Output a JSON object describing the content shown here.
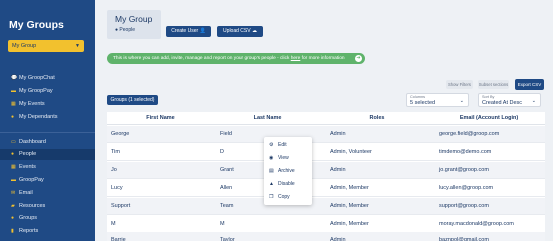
{
  "sidebar": {
    "title": "My Groups",
    "group_select": "My Group",
    "items": [
      {
        "label": "My GroopChat",
        "icon": "chat-icon",
        "glyph": "💬"
      },
      {
        "label": "My GroopPay",
        "icon": "card-icon",
        "glyph": "▬"
      },
      {
        "label": "My Events",
        "icon": "calendar-icon",
        "glyph": "▦"
      },
      {
        "label": "My Dependants",
        "icon": "users-icon",
        "glyph": "●"
      },
      {
        "label": "Dashboard",
        "icon": "dashboard-icon",
        "glyph": "▭"
      },
      {
        "label": "People",
        "icon": "people-icon",
        "glyph": "●"
      },
      {
        "label": "Events",
        "icon": "calendar-icon",
        "glyph": "▦"
      },
      {
        "label": "GroopPay",
        "icon": "card-icon",
        "glyph": "▬"
      },
      {
        "label": "Email",
        "icon": "mail-icon",
        "glyph": "✉"
      },
      {
        "label": "Resources",
        "icon": "folder-icon",
        "glyph": "▰"
      },
      {
        "label": "Groups",
        "icon": "groups-icon",
        "glyph": "●"
      },
      {
        "label": "Reports",
        "icon": "chart-icon",
        "glyph": "▮"
      }
    ]
  },
  "header": {
    "title": "My Group",
    "subtitle": "People",
    "create_user": "Create User",
    "upload_csv": "Upload CSV"
  },
  "banner": {
    "text_before": "This is where you can add, invite, manage and report on your group's people - click ",
    "link": "here",
    "text_after": " for more information"
  },
  "toolbar": {
    "show_filters": "Show Filters",
    "subset_sections": "Subset sections",
    "export_csv": "Export CSV",
    "groups_button": "Groups (1 selected)",
    "columns_label": "Columns",
    "columns_value": "5 selected",
    "sort_label": "Sort By",
    "sort_value": "Created At Desc"
  },
  "table": {
    "headers": [
      "First Name",
      "Last Name",
      "Roles",
      "Email (Account Login)"
    ],
    "rows": [
      {
        "first": "George",
        "last": "Field",
        "roles": "Admin",
        "email": "george.field@groop.com"
      },
      {
        "first": "Tim",
        "last": "D",
        "roles": "Admin, Volunteer",
        "email": "timdemo@demo.com"
      },
      {
        "first": "Jo",
        "last": "Grant",
        "roles": "Admin",
        "email": "jo.grant@groop.com"
      },
      {
        "first": "Lucy",
        "last": "Allen",
        "roles": "Admin, Member",
        "email": "lucy.allen@groop.com"
      },
      {
        "first": "Support",
        "last": "Team",
        "roles": "Admin, Member",
        "email": "support@groop.com"
      },
      {
        "first": "M",
        "last": "M",
        "roles": "Admin, Member",
        "email": "moray.macdonald@groop.com"
      },
      {
        "first": "Barrie",
        "last": "Taylor",
        "roles": "Admin",
        "email": "baznpol@gmail.com"
      }
    ]
  },
  "context_menu": [
    {
      "label": "Edit",
      "icon": "gear-icon",
      "glyph": "⚙"
    },
    {
      "label": "View",
      "icon": "eye-icon",
      "glyph": "◉"
    },
    {
      "label": "Archive",
      "icon": "archive-icon",
      "glyph": "▤"
    },
    {
      "label": "Disable",
      "icon": "warning-icon",
      "glyph": "▲"
    },
    {
      "label": "Copy",
      "icon": "copy-icon",
      "glyph": "❐"
    }
  ]
}
